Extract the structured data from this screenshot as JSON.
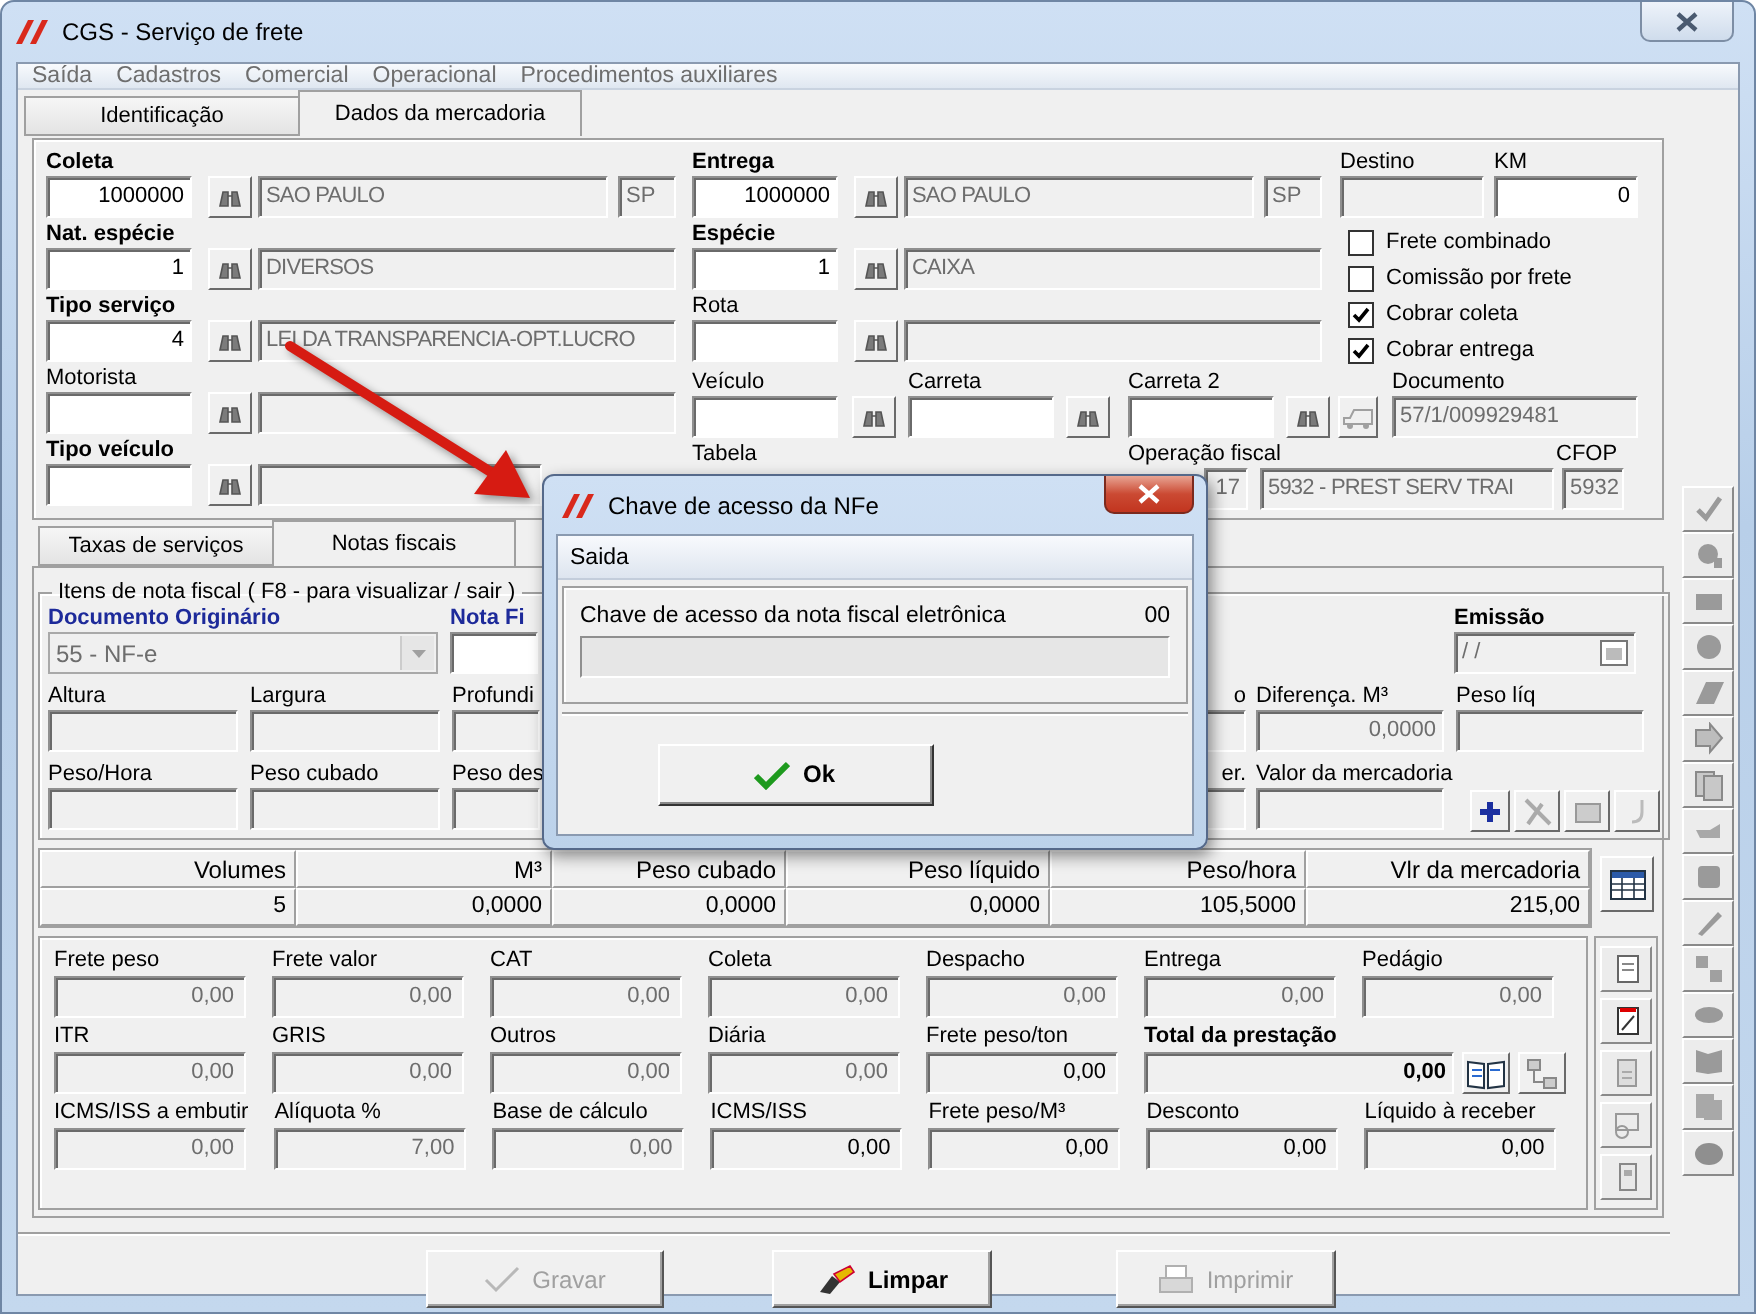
{
  "window": {
    "title": "CGS - Serviço de frete"
  },
  "menu": [
    {
      "label": "Saída"
    },
    {
      "label": "Cadastros"
    },
    {
      "label": "Comercial"
    },
    {
      "label": "Operacional"
    },
    {
      "label": "Procedimentos auxiliares"
    }
  ],
  "tabs": [
    {
      "label": "Identificação",
      "selected": false
    },
    {
      "label": "Dados da mercadoria",
      "selected": true
    }
  ],
  "lookups_left": [
    {
      "label": "Coleta",
      "required": true,
      "code": "1000000",
      "description": "SAO PAULO",
      "uf": "SP"
    },
    {
      "label": "Nat. espécie",
      "required": true,
      "code": "1",
      "description": "DIVERSOS"
    },
    {
      "label": "Tipo serviço",
      "required": true,
      "code": "4",
      "description": "LEI DA TRANSPARENCIA-OPT.LUCRO"
    },
    {
      "label": "Motorista",
      "required": false
    },
    {
      "label": "Tipo veículo",
      "required": true
    }
  ],
  "lookups_mid": [
    {
      "label": "Entrega",
      "required": true,
      "code": "1000000",
      "description": "SAO PAULO",
      "uf": "SP"
    },
    {
      "label": "Espécie",
      "required": true,
      "code": "1",
      "description": "CAIXA"
    },
    {
      "label": "Rota",
      "required": false
    }
  ],
  "destino": {
    "label": "Destino"
  },
  "km": {
    "label": "KM",
    "value": "0"
  },
  "options": [
    {
      "label": "Frete combinado",
      "checked": false
    },
    {
      "label": "Comissão por frete",
      "checked": false
    },
    {
      "label": "Cobrar coleta",
      "checked": true
    },
    {
      "label": "Cobrar entrega",
      "checked": true
    }
  ],
  "vehicle_row": {
    "veiculo": {
      "label": "Veículo"
    },
    "carreta": {
      "label": "Carreta"
    },
    "carreta_2": {
      "label": "Carreta 2"
    },
    "documento": {
      "label": "Documento",
      "value": "57/1/009929481"
    }
  },
  "fiscal_row": {
    "tabela": {
      "label": "Tabela"
    },
    "operacao": {
      "label": "Operação fiscal",
      "code": "17",
      "description": "5932 - PREST SERV TRAI"
    },
    "cfop": {
      "label": "CFOP",
      "value": "5932"
    }
  },
  "lower_tabs": [
    {
      "label": "Taxas de serviços",
      "selected": false
    },
    {
      "label": "Notas fiscais",
      "selected": true
    }
  ],
  "invoice_items": {
    "legend": "Itens de nota fiscal ( F8 - para visualizar / sair )",
    "documento": {
      "label": "Documento Originário",
      "value": "55 - NF-e"
    },
    "nota": {
      "label": "Nota Fi"
    },
    "emissao": {
      "label": "Emissão",
      "value": "/ /"
    }
  },
  "measures": [
    [
      {
        "label": "Altura"
      },
      {
        "label": "Largura"
      },
      {
        "label": "Profundi"
      },
      {
        "label": "o"
      },
      {
        "label": "Diferença. M³",
        "value": "0,0000"
      },
      {
        "label": "Peso líq"
      }
    ],
    [
      {
        "label": "Peso/Hora"
      },
      {
        "label": "Peso cubado"
      },
      {
        "label": "Peso des"
      },
      {
        "label": "er."
      },
      {
        "label": "Valor da mercadoria"
      }
    ]
  ],
  "summary": {
    "columns": [
      "Volumes",
      "M³",
      "Peso cubado",
      "Peso líquido",
      "Peso/hora",
      "Vlr da mercadoria"
    ],
    "values": [
      "5",
      "0,0000",
      "0,0000",
      "0,0000",
      "105,5000",
      "215,00"
    ]
  },
  "charges": [
    [
      {
        "kind": "field",
        "label": "Frete peso",
        "value": "0,00",
        "disabled": true
      },
      {
        "kind": "field",
        "label": "Frete valor",
        "value": "0,00",
        "disabled": true
      },
      {
        "kind": "field",
        "label": "CAT",
        "value": "0,00",
        "disabled": true
      },
      {
        "kind": "field",
        "label": "Coleta",
        "value": "0,00",
        "disabled": true
      },
      {
        "kind": "field",
        "label": "Despacho",
        "value": "0,00",
        "disabled": true
      },
      {
        "kind": "field",
        "label": "Entrega",
        "value": "0,00",
        "disabled": true
      },
      {
        "kind": "field",
        "label": "Pedágio",
        "value": "0,00",
        "disabled": true
      }
    ],
    [
      {
        "kind": "field",
        "label": "ITR",
        "value": "0,00",
        "disabled": true
      },
      {
        "kind": "field",
        "label": "GRIS",
        "value": "0,00",
        "disabled": true
      },
      {
        "kind": "field",
        "label": "Outros",
        "value": "0,00",
        "disabled": true
      },
      {
        "kind": "field",
        "label": "Diária",
        "value": "0,00",
        "disabled": true
      },
      {
        "kind": "field",
        "label": "Frete peso/ton",
        "value": "0,00",
        "disabled": false
      },
      {
        "kind": "total",
        "label": "Total da prestação",
        "value": "0,00",
        "disabled": false
      }
    ],
    [
      {
        "kind": "field",
        "label": "ICMS/ISS a embutir",
        "value": "0,00",
        "disabled": true
      },
      {
        "kind": "field",
        "label": "Alíquota %",
        "value": "7,00",
        "disabled": true
      },
      {
        "kind": "field",
        "label": "Base de cálculo",
        "value": "0,00",
        "disabled": true
      },
      {
        "kind": "field",
        "label": "ICMS/ISS",
        "value": "0,00",
        "disabled": false
      },
      {
        "kind": "field",
        "label": "Frete peso/M³",
        "value": "0,00",
        "disabled": false
      },
      {
        "kind": "field",
        "label": "Desconto",
        "value": "0,00",
        "disabled": false
      },
      {
        "kind": "field",
        "label": "Líquido à receber",
        "value": "0,00",
        "disabled": false
      }
    ]
  ],
  "actions": [
    {
      "label": "Gravar",
      "disabled": true
    },
    {
      "label": "Limpar",
      "disabled": false
    },
    {
      "label": "Imprimir",
      "disabled": true
    }
  ],
  "dialog": {
    "title": "Chave de acesso da NFe",
    "menu": "Saida",
    "prompt": "Chave de acesso da nota fiscal eletrônica",
    "counter": "00",
    "button": "Ok"
  }
}
